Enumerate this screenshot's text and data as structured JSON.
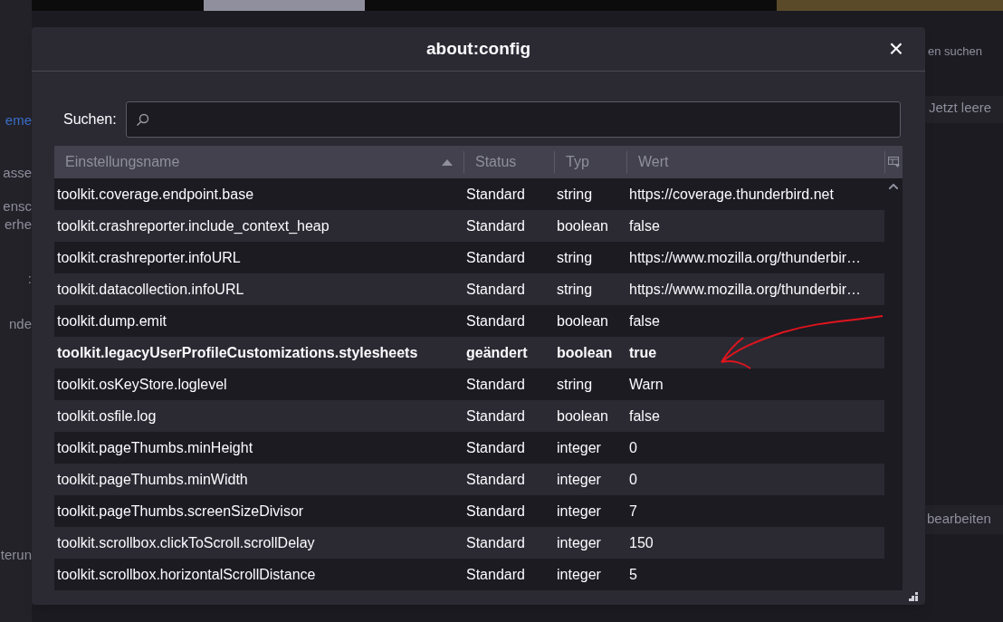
{
  "background": {
    "fragments_left": [
      {
        "text": "eme",
        "kind": "link"
      },
      {
        "text": "asse",
        "kind": "text"
      },
      {
        "text": "ensc",
        "kind": "text"
      },
      {
        "text": "erhe",
        "kind": "text"
      },
      {
        "text": ":",
        "kind": "text"
      },
      {
        "text": "nde",
        "kind": "text"
      },
      {
        "text": "terun",
        "kind": "text"
      }
    ],
    "search_fragment": "en suchen",
    "button_top": "Jetzt leere",
    "button_bottom": "bearbeiten"
  },
  "dialog": {
    "title": "about:config",
    "close": "×"
  },
  "search": {
    "label": "Suchen:"
  },
  "table": {
    "columns": [
      {
        "label": "Einstellungsname",
        "sorted": true
      },
      {
        "label": "Status",
        "sorted": false
      },
      {
        "label": "Typ",
        "sorted": false
      },
      {
        "label": "Wert",
        "sorted": false
      }
    ],
    "rows": [
      {
        "name": "toolkit.coverage.endpoint.base",
        "status": "Standard",
        "type": "string",
        "value": "https://coverage.thunderbird.net",
        "modified": false
      },
      {
        "name": "toolkit.crashreporter.include_context_heap",
        "status": "Standard",
        "type": "boolean",
        "value": "false",
        "modified": false
      },
      {
        "name": "toolkit.crashreporter.infoURL",
        "status": "Standard",
        "type": "string",
        "value": "https://www.mozilla.org/thunderbir…",
        "modified": false
      },
      {
        "name": "toolkit.datacollection.infoURL",
        "status": "Standard",
        "type": "string",
        "value": "https://www.mozilla.org/thunderbir…",
        "modified": false
      },
      {
        "name": "toolkit.dump.emit",
        "status": "Standard",
        "type": "boolean",
        "value": "false",
        "modified": false
      },
      {
        "name": "toolkit.legacyUserProfileCustomizations.stylesheets",
        "status": "geändert",
        "type": "boolean",
        "value": "true",
        "modified": true
      },
      {
        "name": "toolkit.osKeyStore.loglevel",
        "status": "Standard",
        "type": "string",
        "value": "Warn",
        "modified": false
      },
      {
        "name": "toolkit.osfile.log",
        "status": "Standard",
        "type": "boolean",
        "value": "false",
        "modified": false
      },
      {
        "name": "toolkit.pageThumbs.minHeight",
        "status": "Standard",
        "type": "integer",
        "value": "0",
        "modified": false
      },
      {
        "name": "toolkit.pageThumbs.minWidth",
        "status": "Standard",
        "type": "integer",
        "value": "0",
        "modified": false
      },
      {
        "name": "toolkit.pageThumbs.screenSizeDivisor",
        "status": "Standard",
        "type": "integer",
        "value": "7",
        "modified": false
      },
      {
        "name": "toolkit.scrollbox.clickToScroll.scrollDelay",
        "status": "Standard",
        "type": "integer",
        "value": "150",
        "modified": false
      },
      {
        "name": "toolkit.scrollbox.horizontalScrollDistance",
        "status": "Standard",
        "type": "integer",
        "value": "5",
        "modified": false
      }
    ]
  }
}
